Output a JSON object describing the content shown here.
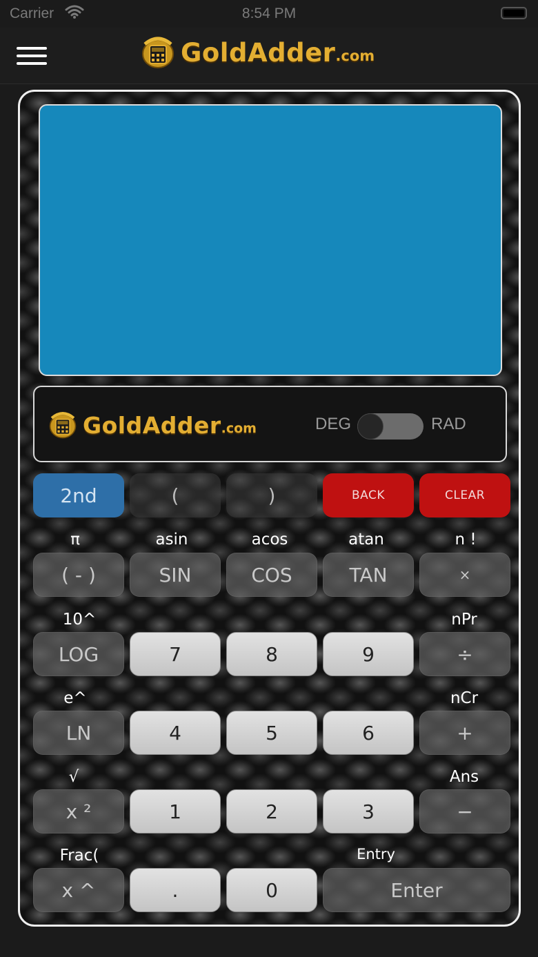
{
  "status_bar": {
    "carrier": "Carrier",
    "time": "8:54 PM"
  },
  "header": {
    "brand_word": "GoldAdder",
    "brand_tld": ".com"
  },
  "mode": {
    "left_label": "DEG",
    "right_label": "RAD",
    "selected": "DEG"
  },
  "watermark": ".com",
  "keys": {
    "second": "2nd",
    "lparen": "(",
    "rparen": ")",
    "back": "BACK",
    "clear": "CLEAR",
    "neg": "( - )",
    "sin": "SIN",
    "cos": "COS",
    "tan": "TAN",
    "mul": "×",
    "log": "LOG",
    "seven": "7",
    "eight": "8",
    "nine": "9",
    "div": "÷",
    "ln": "LN",
    "four": "4",
    "five": "5",
    "six": "6",
    "add": "+",
    "sq": "x ²",
    "one": "1",
    "two": "2",
    "three": "3",
    "sub": "−",
    "pow": "x ^",
    "dot": ".",
    "zero": "0",
    "enter": "Enter"
  },
  "second_labels": {
    "pi": "π",
    "asin": "asin",
    "acos": "acos",
    "atan": "atan",
    "fact": "n !",
    "pow10": "10^",
    "npr": "nPr",
    "exp": "e^",
    "ncr": "nCr",
    "sqrt": "√",
    "ans": "Ans",
    "frac": "Frac(",
    "entry": "Entry"
  },
  "colors": {
    "display": "#1688bb",
    "gold": "#e3ae32",
    "red_key": "#bf1111",
    "blue_key": "#2e6fa8"
  }
}
